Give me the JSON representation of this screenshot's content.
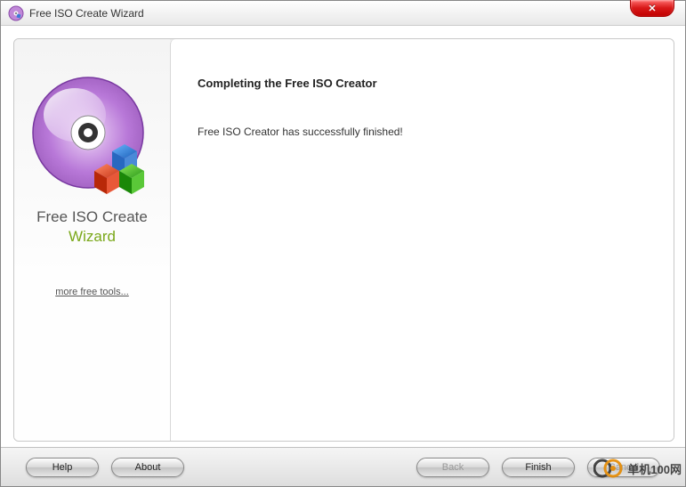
{
  "titlebar": {
    "title": "Free ISO Create Wizard"
  },
  "sidebar": {
    "app_name_line1": "Free ISO Create",
    "app_name_line2": "Wizard",
    "more_tools_link": "more free tools..."
  },
  "main": {
    "heading": "Completing the Free ISO Creator",
    "message": "Free ISO Creator has successfully finished!"
  },
  "footer": {
    "help_label": "Help",
    "about_label": "About",
    "back_label": "Back",
    "finish_label": "Finish",
    "cancel_label": "Cancel"
  },
  "watermark": {
    "text": "单机100网"
  }
}
